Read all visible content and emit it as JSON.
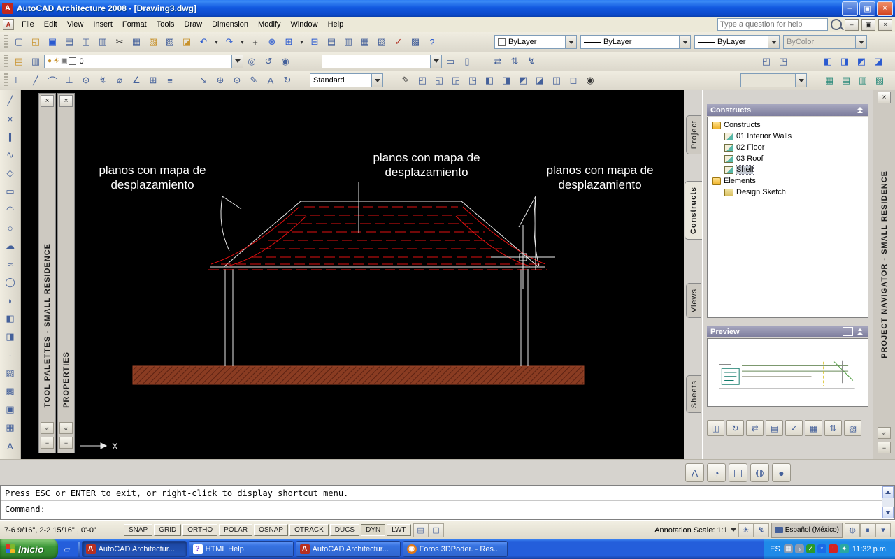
{
  "titlebar": {
    "logo": "A",
    "title": "AutoCAD Architecture 2008 - [Drawing3.dwg]"
  },
  "icons": {
    "minimize": "–",
    "restore": "▣",
    "close": "×",
    "dock": "«",
    "menu": "≡"
  },
  "menubar": {
    "items": [
      "File",
      "Edit",
      "View",
      "Insert",
      "Format",
      "Tools",
      "Draw",
      "Dimension",
      "Modify",
      "Window",
      "Help"
    ],
    "question": "Type a question for help"
  },
  "toolbars": {
    "row1": {
      "icons": [
        {
          "n": "qnew-icon",
          "g": "▢"
        },
        {
          "n": "open-icon",
          "g": "◱",
          "cls": "g-gold"
        },
        {
          "n": "save-icon",
          "g": "▣",
          "cls": "g-blue"
        },
        {
          "n": "plot-icon",
          "g": "▤"
        },
        {
          "n": "plot-preview-icon",
          "g": "◫"
        },
        {
          "n": "publish-icon",
          "g": "▥"
        },
        {
          "n": "cut-icon",
          "g": "✂",
          "cls": "g-dark"
        },
        {
          "n": "copy-icon",
          "g": "▦"
        },
        {
          "n": "paste-icon",
          "g": "▧",
          "cls": "g-gold"
        },
        {
          "n": "match-properties-icon",
          "g": "▨"
        },
        {
          "n": "block-editor-icon",
          "g": "◪",
          "cls": "g-gold"
        },
        {
          "n": "undo-icon",
          "g": "↶",
          "cls": "g-blue"
        },
        {
          "n": "undo-arrow-icon",
          "g": "▾",
          "cls": "sm"
        },
        {
          "n": "redo-icon",
          "g": "↷",
          "cls": "g-blue"
        },
        {
          "n": "redo-arrow-icon",
          "g": "▾",
          "cls": "sm"
        },
        {
          "n": "pan-icon",
          "g": "+",
          "cls": "g-dark"
        },
        {
          "n": "zoom-realtime-icon",
          "g": "⊕",
          "cls": "g-blue"
        },
        {
          "n": "zoom-window-icon",
          "g": "⊞",
          "cls": "g-blue"
        },
        {
          "n": "zoom-arrow-icon",
          "g": "▾",
          "cls": "sm"
        },
        {
          "n": "zoom-previous-icon",
          "g": "⊟",
          "cls": "g-blue"
        },
        {
          "n": "properties-icon",
          "g": "▤"
        },
        {
          "n": "designcenter-icon",
          "g": "▥"
        },
        {
          "n": "toolpalettes-icon",
          "g": "▦"
        },
        {
          "n": "sheetset-icon",
          "g": "▧"
        },
        {
          "n": "markup-icon",
          "g": "✓",
          "cls": "g-red"
        },
        {
          "n": "quickcalc-icon",
          "g": "▩"
        },
        {
          "n": "help-icon",
          "g": "?",
          "cls": "g-blue"
        }
      ],
      "color": "ByLayer",
      "linetype": "ByLayer",
      "lineweight": "ByLayer",
      "plotstyle": "ByColor"
    },
    "row2": {
      "g1": [
        {
          "n": "layer-properties-icon",
          "g": "▤",
          "cls": "g-gold"
        },
        {
          "n": "layer-states-icon",
          "g": "▥"
        }
      ],
      "layer_states": [
        {
          "n": "layer-on-icon",
          "g": "●",
          "cls": "g-gold"
        },
        {
          "n": "layer-thaw-icon",
          "g": "☀",
          "cls": "g-gold"
        },
        {
          "n": "layer-unlock-icon",
          "g": "▣",
          "cls": "g-gray"
        }
      ],
      "layer": "0",
      "g2": [
        {
          "n": "make-object-layer-current-icon",
          "g": "◎"
        },
        {
          "n": "layer-previous-icon",
          "g": "↺"
        },
        {
          "n": "layer-isolate-icon",
          "g": "◉"
        }
      ],
      "combo2": "",
      "g3": [
        {
          "n": "group-icon",
          "g": "▭"
        },
        {
          "n": "ungroup-icon",
          "g": "▯"
        }
      ],
      "g4": [
        {
          "n": "update-icon",
          "g": "⇄"
        },
        {
          "n": "sync-icon",
          "g": "⇅"
        },
        {
          "n": "regen-icon",
          "g": "↯"
        }
      ],
      "g5": [
        {
          "n": "view-prev-icon",
          "g": "◰"
        },
        {
          "n": "view-next-icon",
          "g": "◳"
        }
      ],
      "g6": [
        {
          "n": "layout-icon-1",
          "g": "◧",
          "cls": "g-blue"
        },
        {
          "n": "layout-icon-2",
          "g": "◨",
          "cls": "g-blue"
        },
        {
          "n": "layout-icon-3",
          "g": "◩",
          "cls": "g-blue"
        },
        {
          "n": "layout-icon-4",
          "g": "◪",
          "cls": "g-blue"
        }
      ]
    },
    "row3": {
      "dim_icons": [
        {
          "n": "linear-dimension-icon",
          "g": "⊢"
        },
        {
          "n": "aligned-dimension-icon",
          "g": "╱"
        },
        {
          "n": "arc-length-icon",
          "g": "⌒"
        },
        {
          "n": "ordinate-icon",
          "g": "⊥"
        },
        {
          "n": "radius-icon",
          "g": "⊙"
        },
        {
          "n": "jogged-icon",
          "g": "↯"
        },
        {
          "n": "diameter-icon",
          "g": "⌀"
        },
        {
          "n": "angular-icon",
          "g": "∠"
        },
        {
          "n": "quick-dim-icon",
          "g": "⊞"
        },
        {
          "n": "baseline-icon",
          "g": "≡"
        },
        {
          "n": "continue-icon",
          "g": "="
        },
        {
          "n": "leader-icon",
          "g": "↘"
        },
        {
          "n": "tolerance-icon",
          "g": "⊕"
        },
        {
          "n": "center-mark-icon",
          "g": "⊙"
        },
        {
          "n": "dim-edit-icon",
          "g": "✎"
        },
        {
          "n": "dim-text-edit-icon",
          "g": "A"
        },
        {
          "n": "dim-update-icon",
          "g": "↻"
        }
      ],
      "dimstyle": "Standard",
      "g1": [
        {
          "n": "style-edit-icon",
          "g": "✎",
          "cls": "g-dark"
        },
        {
          "n": "view-top-icon",
          "g": "◰"
        },
        {
          "n": "view-bottom-icon",
          "g": "◱"
        },
        {
          "n": "view-left-icon",
          "g": "◲"
        },
        {
          "n": "view-right-icon",
          "g": "◳"
        },
        {
          "n": "view-front-icon",
          "g": "◧"
        },
        {
          "n": "view-back-icon",
          "g": "◨"
        },
        {
          "n": "view-swiso-icon",
          "g": "◩"
        },
        {
          "n": "view-seiso-icon",
          "g": "◪"
        },
        {
          "n": "view-neiso-icon",
          "g": "◫"
        },
        {
          "n": "view-nwiso-icon",
          "g": "◻"
        },
        {
          "n": "camera-icon",
          "g": "◉",
          "cls": "g-dark"
        }
      ],
      "combo2": "",
      "g2": [
        {
          "n": "workspace-icon-1",
          "g": "▦",
          "cls": "g-teal"
        },
        {
          "n": "workspace-icon-2",
          "g": "▤",
          "cls": "g-teal"
        },
        {
          "n": "workspace-icon-3",
          "g": "▥",
          "cls": "g-teal"
        },
        {
          "n": "workspace-icon-4",
          "g": "▧",
          "cls": "g-teal"
        }
      ]
    }
  },
  "left_toolbar": {
    "icons": [
      {
        "n": "line-icon",
        "g": "╱"
      },
      {
        "n": "construction-line-icon",
        "g": "×"
      },
      {
        "n": "multiline-icon",
        "g": "∥"
      },
      {
        "n": "polyline-icon",
        "g": "∿"
      },
      {
        "n": "polygon-icon",
        "g": "◇"
      },
      {
        "n": "rectangle-icon",
        "g": "▭"
      },
      {
        "n": "arc-icon",
        "g": "◠"
      },
      {
        "n": "circle-icon",
        "g": "○"
      },
      {
        "n": "revcloud-icon",
        "g": "☁"
      },
      {
        "n": "spline-icon",
        "g": "≈"
      },
      {
        "n": "ellipse-icon",
        "g": "◯"
      },
      {
        "n": "ellipse-arc-icon",
        "g": "◗"
      },
      {
        "n": "insert-block-icon",
        "g": "◧"
      },
      {
        "n": "make-block-icon",
        "g": "◨"
      },
      {
        "n": "point-icon",
        "g": "·"
      },
      {
        "n": "hatch-icon",
        "g": "▨"
      },
      {
        "n": "gradient-icon",
        "g": "▩"
      },
      {
        "n": "region-icon",
        "g": "▣"
      },
      {
        "n": "table-icon",
        "g": "▦"
      },
      {
        "n": "mtext-icon",
        "g": "A"
      },
      {
        "n": "dimension-icon",
        "g": "↔"
      }
    ]
  },
  "palettes": {
    "tool": "TOOL PALETTES - SMALL RESIDENCE",
    "props": "PROPERTIES"
  },
  "canvas": {
    "labels": [
      {
        "l1": "planos con mapa de",
        "l2": "desplazamiento"
      },
      {
        "l1": "planos con mapa de",
        "l2": "desplazamiento"
      },
      {
        "l1": "planos con mapa de",
        "l2": "desplazamiento"
      }
    ],
    "ucs": "X"
  },
  "colors": {
    "canvas_bg": "#000000",
    "line_red": "#e01010",
    "slab_brown": "#8a3c22",
    "label_white": "#ffffff",
    "taskbar_blue": "#245edb",
    "start_green": "#3c9838"
  },
  "navigator": {
    "tabs": [
      {
        "label": "Project",
        "cls": "t1"
      },
      {
        "label": "Constructs",
        "cls": "t2 active"
      },
      {
        "label": "Views",
        "cls": "t3"
      },
      {
        "label": "Sheets",
        "cls": "t4"
      }
    ],
    "header": "Constructs",
    "tree": [
      {
        "label": "Constructs",
        "cls": "lvl0 ico-folder"
      },
      {
        "label": "01 Interior Walls",
        "cls": "lvl1 ico-construct"
      },
      {
        "label": "02 Floor",
        "cls": "lvl1 ico-construct"
      },
      {
        "label": "03 Roof",
        "cls": "lvl1 ico-construct"
      },
      {
        "label": "Shell",
        "cls": "lvl1 ico-construct sel"
      },
      {
        "label": "Elements",
        "cls": "lvl0 ico-folder"
      },
      {
        "label": "Design Sketch",
        "cls": "lvl1 ico-element"
      }
    ],
    "preview_header": "Preview",
    "bottom_icons": [
      {
        "n": "preview-toggle-icon",
        "g": "◫"
      },
      {
        "n": "refresh-project-icon",
        "g": "↻"
      },
      {
        "n": "repath-icon",
        "g": "⇄"
      },
      {
        "n": "add-construct-icon",
        "g": "▤"
      },
      {
        "n": "check-icon",
        "g": "✓"
      },
      {
        "n": "table-icon",
        "g": "▦"
      },
      {
        "n": "sync-icon",
        "g": "⇅"
      },
      {
        "n": "publish-icon",
        "g": "▧"
      }
    ],
    "strip": "PROJECT NAVIGATOR - SMALL RESIDENCE"
  },
  "band_icons": [
    {
      "n": "annotation-tool-icon",
      "g": "A",
      "cls": "g-dark"
    },
    {
      "n": "sphere-icon",
      "g": "◔"
    },
    {
      "n": "viewport-icon",
      "g": "◫"
    },
    {
      "n": "globe-icon",
      "g": "◍",
      "cls": "g-blue"
    },
    {
      "n": "render-ball-icon",
      "g": "●",
      "cls": "g-orange"
    }
  ],
  "command": {
    "line1": "Press ESC or ENTER to exit, or right-click to display shortcut menu.",
    "prompt": "Command:"
  },
  "status": {
    "coords": "7-6 9/16\", 2-2 15/16\" , 0'-0\"",
    "toggles": [
      {
        "label": "SNAP"
      },
      {
        "label": "GRID"
      },
      {
        "label": "ORTHO"
      },
      {
        "label": "POLAR"
      },
      {
        "label": "OSNAP"
      },
      {
        "label": "OTRACK"
      },
      {
        "label": "DUCS"
      },
      {
        "label": "DYN",
        "cls": "pressed"
      },
      {
        "label": "LWT"
      }
    ],
    "model_icons": [
      {
        "n": "model-space-icon",
        "g": "▤"
      },
      {
        "n": "layout-space-icon",
        "g": "◫"
      }
    ],
    "scale_label": "Annotation Scale: 1:1",
    "scale_icons": [
      {
        "n": "annotation-visibility-icon",
        "g": "☀",
        "cls": "g-gold"
      },
      {
        "n": "annotation-autoscale-icon",
        "g": "↯",
        "cls": "g-gold"
      }
    ],
    "language": "Español (México)",
    "right_icons": [
      {
        "n": "comm-center-icon",
        "g": "◍",
        "cls": "g-blue"
      },
      {
        "n": "toolbar-lock-icon",
        "g": "∎",
        "cls": "g-gold"
      },
      {
        "n": "status-menu-icon",
        "g": "▾",
        "cls": "g-dark"
      }
    ]
  },
  "taskbar": {
    "start": "Inicio",
    "quicklaunch": [
      {
        "n": "show-desktop-icon",
        "g": "▱"
      }
    ],
    "tasks": [
      {
        "label": "AutoCAD Architectur...",
        "cls": "pressed i-acad",
        "ig": "A"
      },
      {
        "label": "HTML Help",
        "cls": "i-help",
        "ig": "?"
      },
      {
        "label": "AutoCAD Architectur...",
        "cls": "i-acad",
        "ig": "A"
      },
      {
        "label": "Foros 3DPoder. - Res...",
        "cls": "i-ff",
        "ig": "◉"
      }
    ],
    "tray_label": "ES",
    "tray_icons": [
      {
        "n": "tray-display-icon",
        "g": "▦",
        "cls": "bg-gray"
      },
      {
        "n": "tray-volume-icon",
        "g": "♪",
        "cls": "bg-gray"
      },
      {
        "n": "tray-antivirus-icon",
        "g": "✓",
        "cls": "bg-green"
      },
      {
        "n": "tray-bluetooth-icon",
        "g": "*",
        "cls": "bg-blue"
      },
      {
        "n": "tray-alert-icon",
        "g": "!",
        "cls": "bg-red"
      },
      {
        "n": "tray-messenger-icon",
        "g": "✦",
        "cls": "bg-teal"
      }
    ],
    "time": "11:32 p.m."
  }
}
